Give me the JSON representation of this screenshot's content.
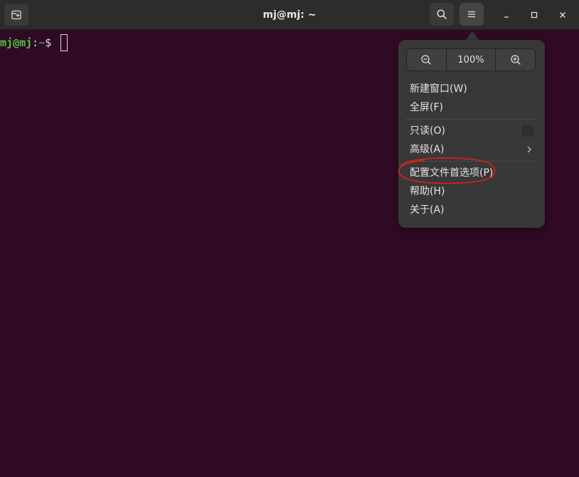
{
  "window": {
    "title": "mj@mj: ~"
  },
  "terminal": {
    "prompt_user": "mj@mj",
    "prompt_sep": ":",
    "prompt_path": "~",
    "prompt_dollar": "$ "
  },
  "menu": {
    "zoom_level": "100%",
    "items": [
      {
        "label": "新建窗口(W)"
      },
      {
        "label": "全屏(F)"
      },
      {
        "label": "只读(O)"
      },
      {
        "label": "高级(A)"
      },
      {
        "label": "配置文件首选项(P)"
      },
      {
        "label": "帮助(H)"
      },
      {
        "label": "关于(A)"
      }
    ]
  },
  "colors": {
    "terminal_bg": "#300a24",
    "titlebar_bg": "#2c2c2c",
    "popover_bg": "#383838",
    "prompt_user": "#4ec23f",
    "prompt_path": "#4e7fd8",
    "annotation": "#e0201a"
  },
  "icons": {
    "new_tab": "new-tab-icon",
    "search": "search-icon",
    "menu": "hamburger-menu-icon",
    "minimize": "minimize-icon",
    "maximize": "maximize-icon",
    "close": "close-icon",
    "zoom_out": "zoom-out-icon",
    "zoom_in": "zoom-in-icon",
    "submenu": "chevron-right-icon"
  }
}
